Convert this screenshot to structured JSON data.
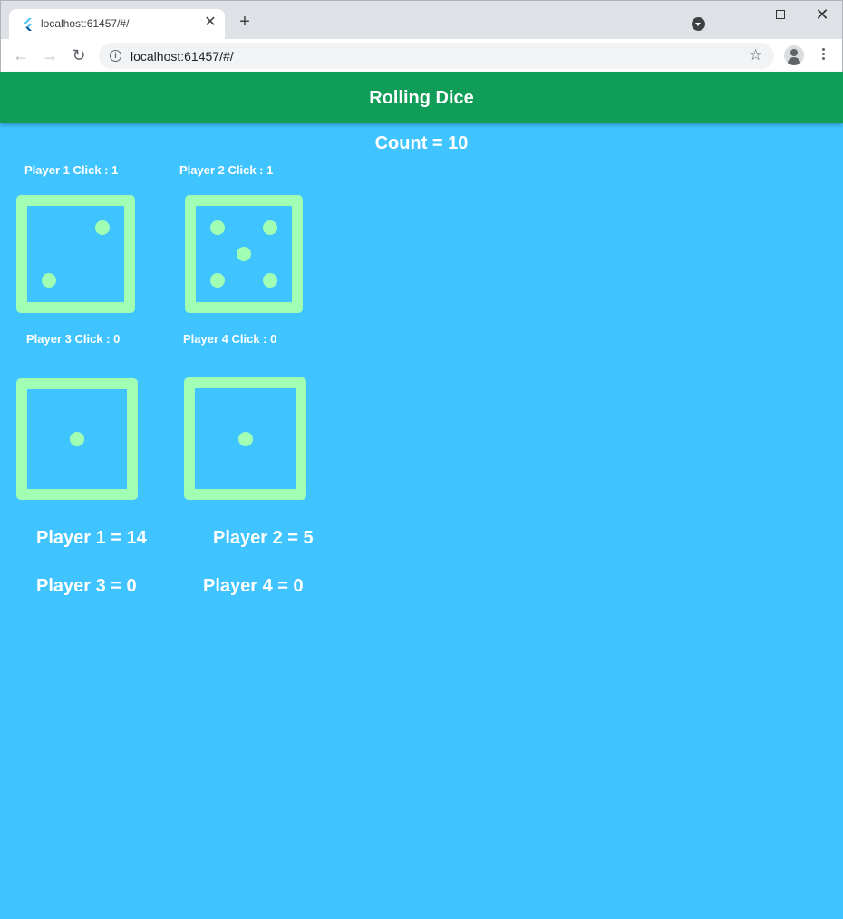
{
  "browser": {
    "tab_title": "localhost:61457/#/",
    "url": "localhost:61457/#/",
    "tab_close": "✕",
    "new_tab": "+"
  },
  "app": {
    "title": "Rolling Dice",
    "count_text": "Count = 10",
    "theme": {
      "appbar_color": "#0f9d58",
      "background_color": "#40c4ff",
      "dice_color": "#a1ffb4"
    }
  },
  "players": [
    {
      "click_label": "Player 1 Click : 1",
      "die_face": 2,
      "score_text": "Player 1 = 14"
    },
    {
      "click_label": "Player 2 Click : 1",
      "die_face": 5,
      "score_text": "Player 2 = 5"
    },
    {
      "click_label": "Player 3 Click : 0",
      "die_face": 1,
      "score_text": "Player 3 = 0"
    },
    {
      "click_label": "Player 4 Click : 0",
      "die_face": 1,
      "score_text": "Player 4 = 0"
    }
  ]
}
